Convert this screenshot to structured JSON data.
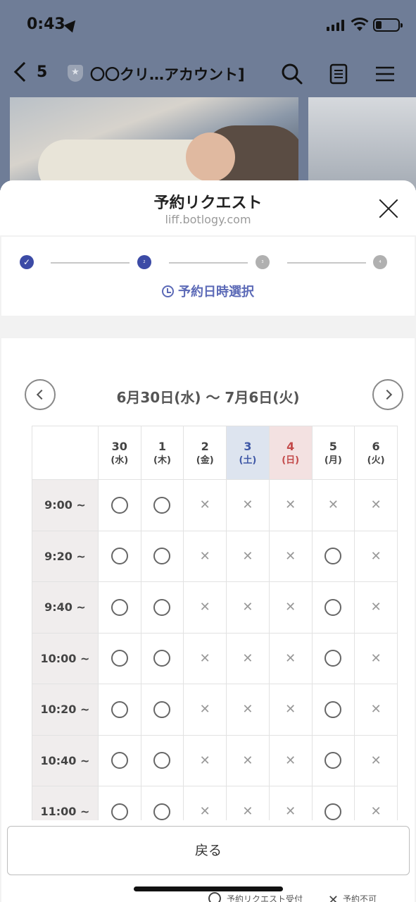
{
  "status_bar": {
    "time": "0:43"
  },
  "chat_header": {
    "back_count": "5",
    "title": "〇〇クリ…アカウント]"
  },
  "sheet": {
    "title": "予約リクエスト",
    "url": "liff.botlogy.com"
  },
  "steps": {
    "items": [
      {
        "state": "done",
        "label": "✓"
      },
      {
        "state": "current",
        "label": "2"
      },
      {
        "state": "pending",
        "label": "3"
      },
      {
        "state": "pending",
        "label": "4"
      }
    ],
    "current_label": "予約日時選択"
  },
  "calendar": {
    "range": "6月30日(水)  ～  7月6日(火)",
    "days": [
      {
        "date": "30",
        "dow": "(水)",
        "kind": "weekday"
      },
      {
        "date": "1",
        "dow": "(木)",
        "kind": "weekday"
      },
      {
        "date": "2",
        "dow": "(金)",
        "kind": "weekday"
      },
      {
        "date": "3",
        "dow": "(土)",
        "kind": "sat"
      },
      {
        "date": "4",
        "dow": "(日)",
        "kind": "sun"
      },
      {
        "date": "5",
        "dow": "(月)",
        "kind": "weekday"
      },
      {
        "date": "6",
        "dow": "(火)",
        "kind": "weekday"
      }
    ],
    "slots": [
      {
        "time": "9:00 ~",
        "avail": [
          "o",
          "o",
          "x",
          "x",
          "x",
          "x",
          "x"
        ]
      },
      {
        "time": "9:20 ~",
        "avail": [
          "o",
          "o",
          "x",
          "x",
          "x",
          "o",
          "x"
        ]
      },
      {
        "time": "9:40 ~",
        "avail": [
          "o",
          "o",
          "x",
          "x",
          "x",
          "o",
          "x"
        ]
      },
      {
        "time": "10:00 ~",
        "avail": [
          "o",
          "o",
          "x",
          "x",
          "x",
          "o",
          "x"
        ]
      },
      {
        "time": "10:20 ~",
        "avail": [
          "o",
          "o",
          "x",
          "x",
          "x",
          "o",
          "x"
        ]
      },
      {
        "time": "10:40 ~",
        "avail": [
          "o",
          "o",
          "x",
          "x",
          "x",
          "o",
          "x"
        ]
      },
      {
        "time": "11:00 ~",
        "avail": [
          "o",
          "o",
          "x",
          "x",
          "x",
          "o",
          "x"
        ]
      }
    ],
    "available_symbol": "○",
    "unavailable_symbol": "×"
  },
  "back_button": {
    "label": "戻る"
  },
  "legend": {
    "available": "予約リクエスト受付",
    "unavailable": "予約不可"
  }
}
